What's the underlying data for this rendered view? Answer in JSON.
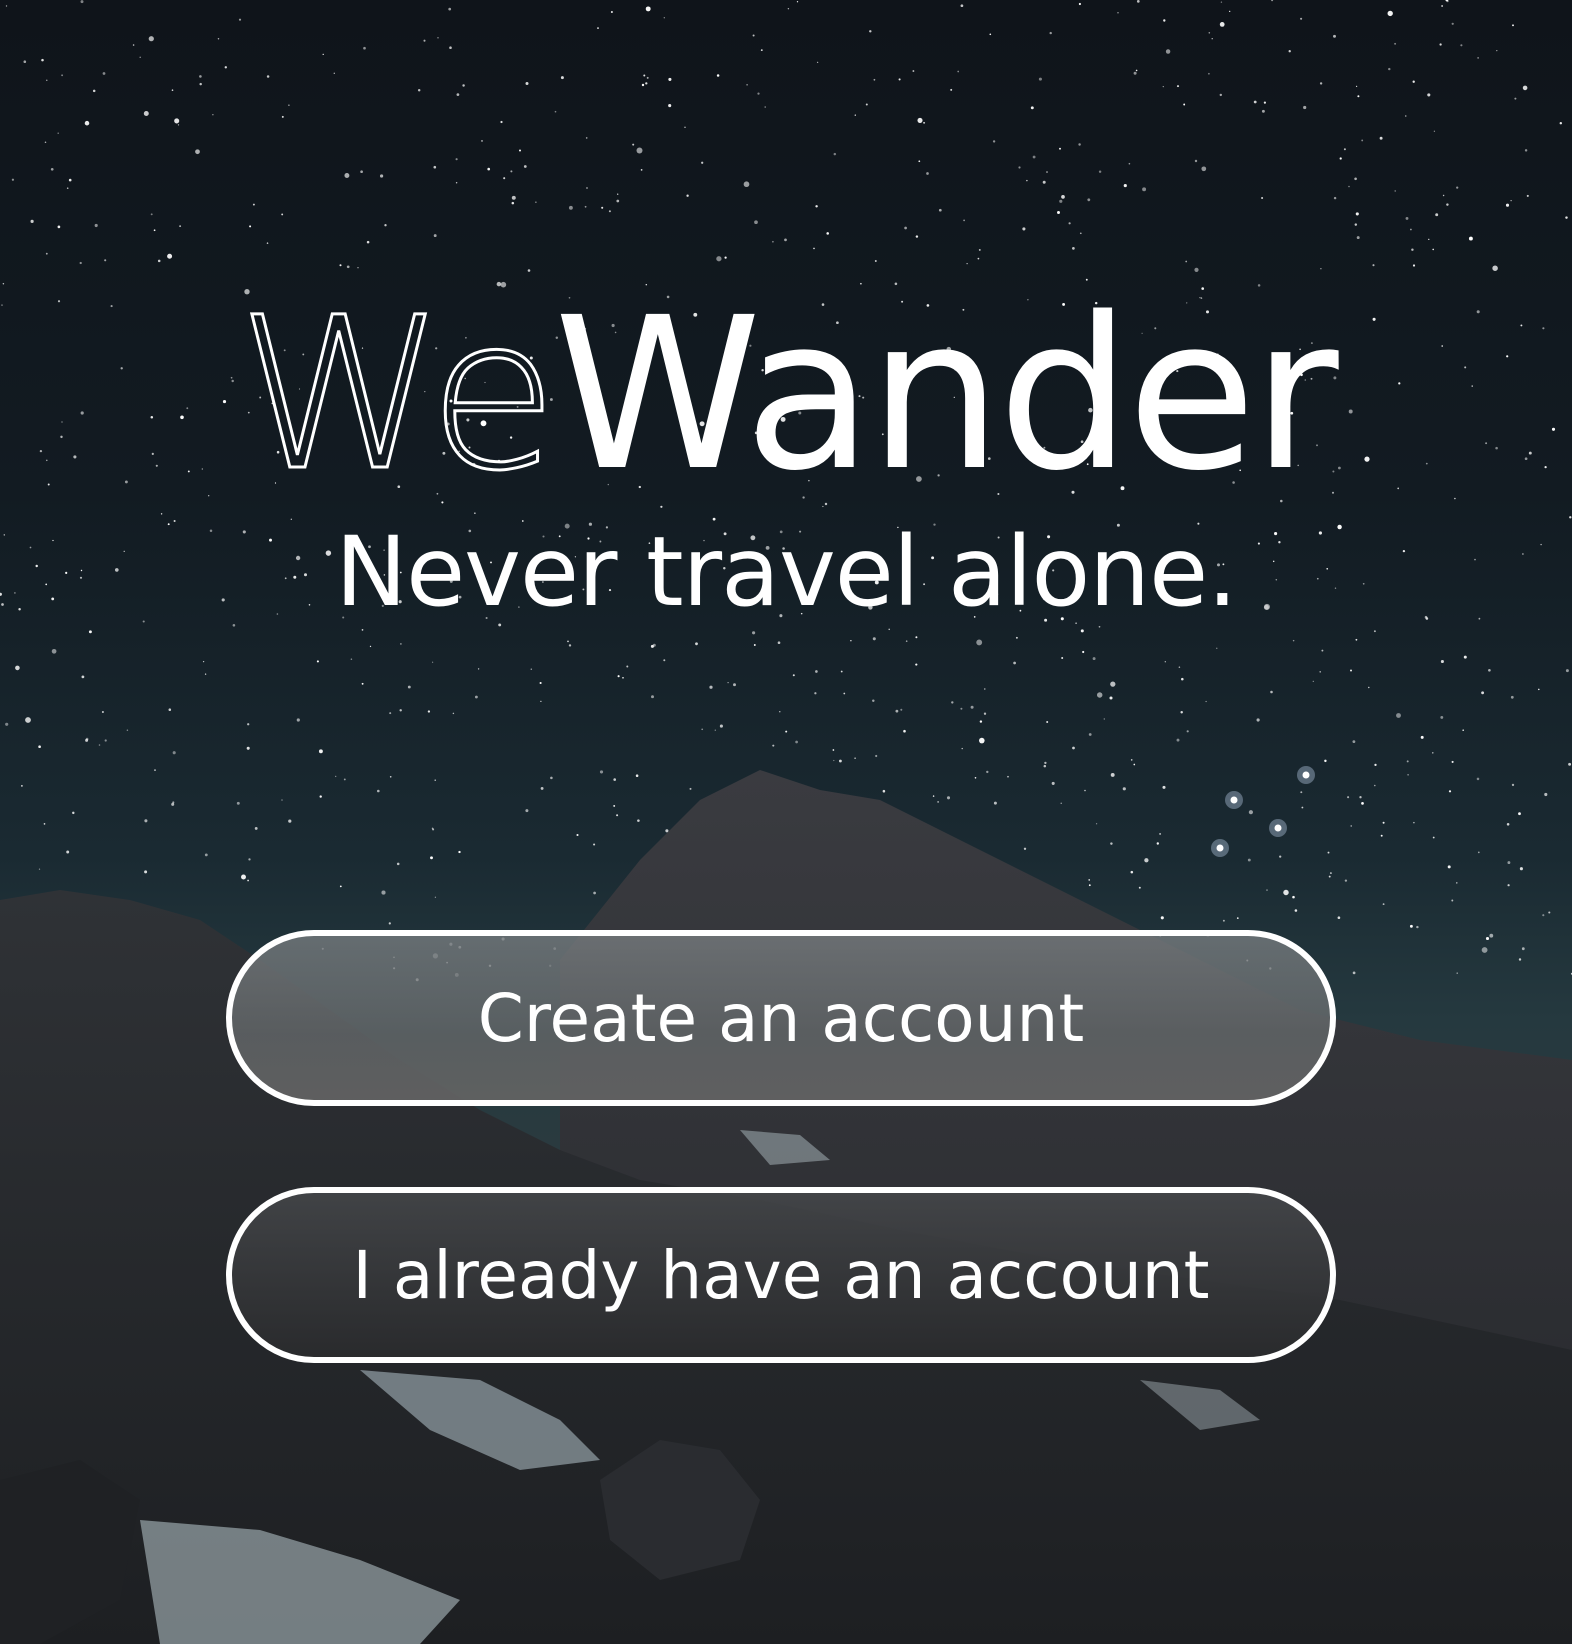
{
  "app": {
    "name_part_outline": "We",
    "name_part_solid": "Wander",
    "tagline": "Never travel alone."
  },
  "actions": {
    "create_account_label": "Create an account",
    "login_label": "I already have an account"
  },
  "colors": {
    "text": "#ffffff",
    "sky_top": "#0f141a",
    "sky_horizon": "#25393f",
    "rock": "#2c2f33"
  }
}
